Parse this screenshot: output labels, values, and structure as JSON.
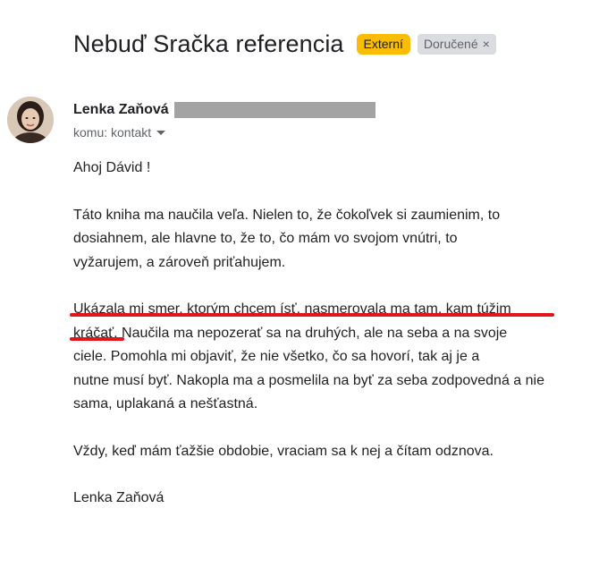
{
  "email": {
    "subject": "Nebuď Sračka referencia",
    "labels": {
      "external": "Externí",
      "inbox": "Doručené",
      "inbox_remove": "×"
    },
    "sender": {
      "name": "Lenka Zaňová",
      "to_line": "komu: kontakt"
    },
    "body": {
      "greeting": "Ahoj Dávid !",
      "para1_line1": "Táto kniha ma naučila veľa. Nielen to, že čokoľvek si zaumienim, to",
      "para1_line2": "dosiahnem, ale hlavne to, že to, čo mám vo svojom vnútri, to",
      "para1_line3": "vyžarujem, a zároveň priťahujem.",
      "para2_line1": "Ukázala mi smer, ktorým chcem ísť, nasmerovala ma tam, kam túžim",
      "para2_line2": "kráčať. Naučila ma nepozerať sa na druhých, ale na seba a na svoje",
      "para2_line3": "ciele. Pomohla mi objaviť, že nie všetko, čo sa hovorí, tak aj je a",
      "para2_line4": "nutne musí byť. Nakopla ma a posmelila na byť za seba zodpovedná a nie",
      "para2_line5": "sama, uplakaná a nešťastná.",
      "para3_line1": "Vždy, keď mám ťažšie obdobie, vraciam sa k nej a čítam odznova.",
      "signature": "Lenka Zaňová"
    }
  },
  "colors": {
    "external_badge": "#fbbc04",
    "inbox_badge": "#dadce0",
    "annotation_underline": "#e3141c",
    "redaction": "#a3a3a3"
  }
}
